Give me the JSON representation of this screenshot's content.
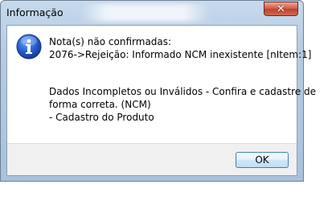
{
  "dialog": {
    "title": "Informação",
    "close_label": "✕",
    "icon": "info-icon",
    "lines": [
      "Nota(s) não confirmadas:",
      "2076->Rejeição: Informado NCM inexistente [nItem:1]",
      "Dados Incompletos ou Inválidos - Confira e cadastre de",
      "forma correta. (NCM)",
      "- Cadastro do Produto"
    ],
    "ok_label": "OK"
  },
  "colors": {
    "titlebar": "#b4cbe3",
    "close_button": "#c3412b",
    "icon_blue": "#1f4fb6",
    "button_border": "#3c7fb1"
  }
}
